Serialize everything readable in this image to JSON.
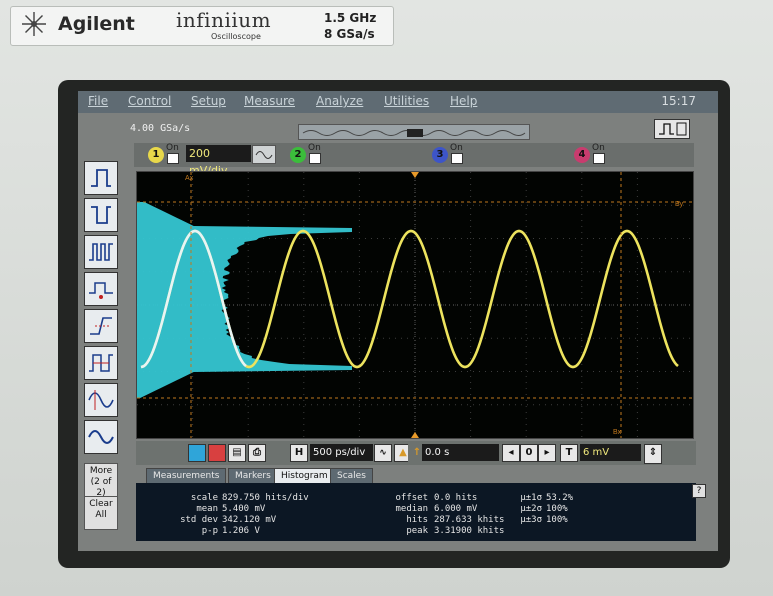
{
  "branding": {
    "brand": "Agilent",
    "product": "infiniium",
    "product_sub": "Oscilloscope",
    "bandwidth": "1.5 GHz",
    "sample_rate_max": "8 GSa/s"
  },
  "menu": {
    "items": [
      "File",
      "Control",
      "Setup",
      "Measure",
      "Analyze",
      "Utilities",
      "Help"
    ],
    "clock": "15:17"
  },
  "acquisition": {
    "sample_rate": "4.00 GSa/s"
  },
  "channels": [
    {
      "number": "1",
      "state": "On",
      "scale": "200 mV/div",
      "color": "#e8d84a"
    },
    {
      "number": "2",
      "state": "On",
      "color": "#3bbd3b"
    },
    {
      "number": "3",
      "state": "On",
      "color": "#3d55c8"
    },
    {
      "number": "4",
      "state": "On",
      "color": "#c83c6e"
    }
  ],
  "timebase": {
    "h_label": "H",
    "scale": "500 ps/div",
    "delay": "0.0 s",
    "trigger_label": "T",
    "trigger_level": "6 mV"
  },
  "side_panel": {
    "more_label": "More",
    "more_page": "(2 of 2)",
    "clear_line1": "Clear",
    "clear_line2": "All"
  },
  "tabs": [
    "Measurements",
    "Markers",
    "Histogram",
    "Scales"
  ],
  "active_tab": "Histogram",
  "histogram": {
    "col1": [
      {
        "label": "scale",
        "value": "829.750 hits/div"
      },
      {
        "label": "mean",
        "value": "5.400 mV"
      },
      {
        "label": "std dev",
        "value": "342.120 mV"
      },
      {
        "label": "p-p",
        "value": "1.206 V"
      }
    ],
    "col2": [
      {
        "label": "offset",
        "value": "0.0 hits"
      },
      {
        "label": "median",
        "value": "6.000 mV"
      },
      {
        "label": "hits",
        "value": "287.633 khits"
      },
      {
        "label": "peak",
        "value": "3.31900 khits"
      }
    ],
    "col3": [
      {
        "label": "μ±1σ",
        "value": "53.2%"
      },
      {
        "label": "μ±2σ",
        "value": "100%"
      },
      {
        "label": "μ±3σ",
        "value": "100%"
      }
    ]
  },
  "markers": {
    "ax": "Ax",
    "bx": "Bx",
    "by": "By",
    "ay": "Ay"
  },
  "help_label": "?",
  "trace_colors": {
    "signal": "#ede35e",
    "histogram": "#35c6d2",
    "grid": "#3c3c3c",
    "markers": "#c0781e"
  }
}
